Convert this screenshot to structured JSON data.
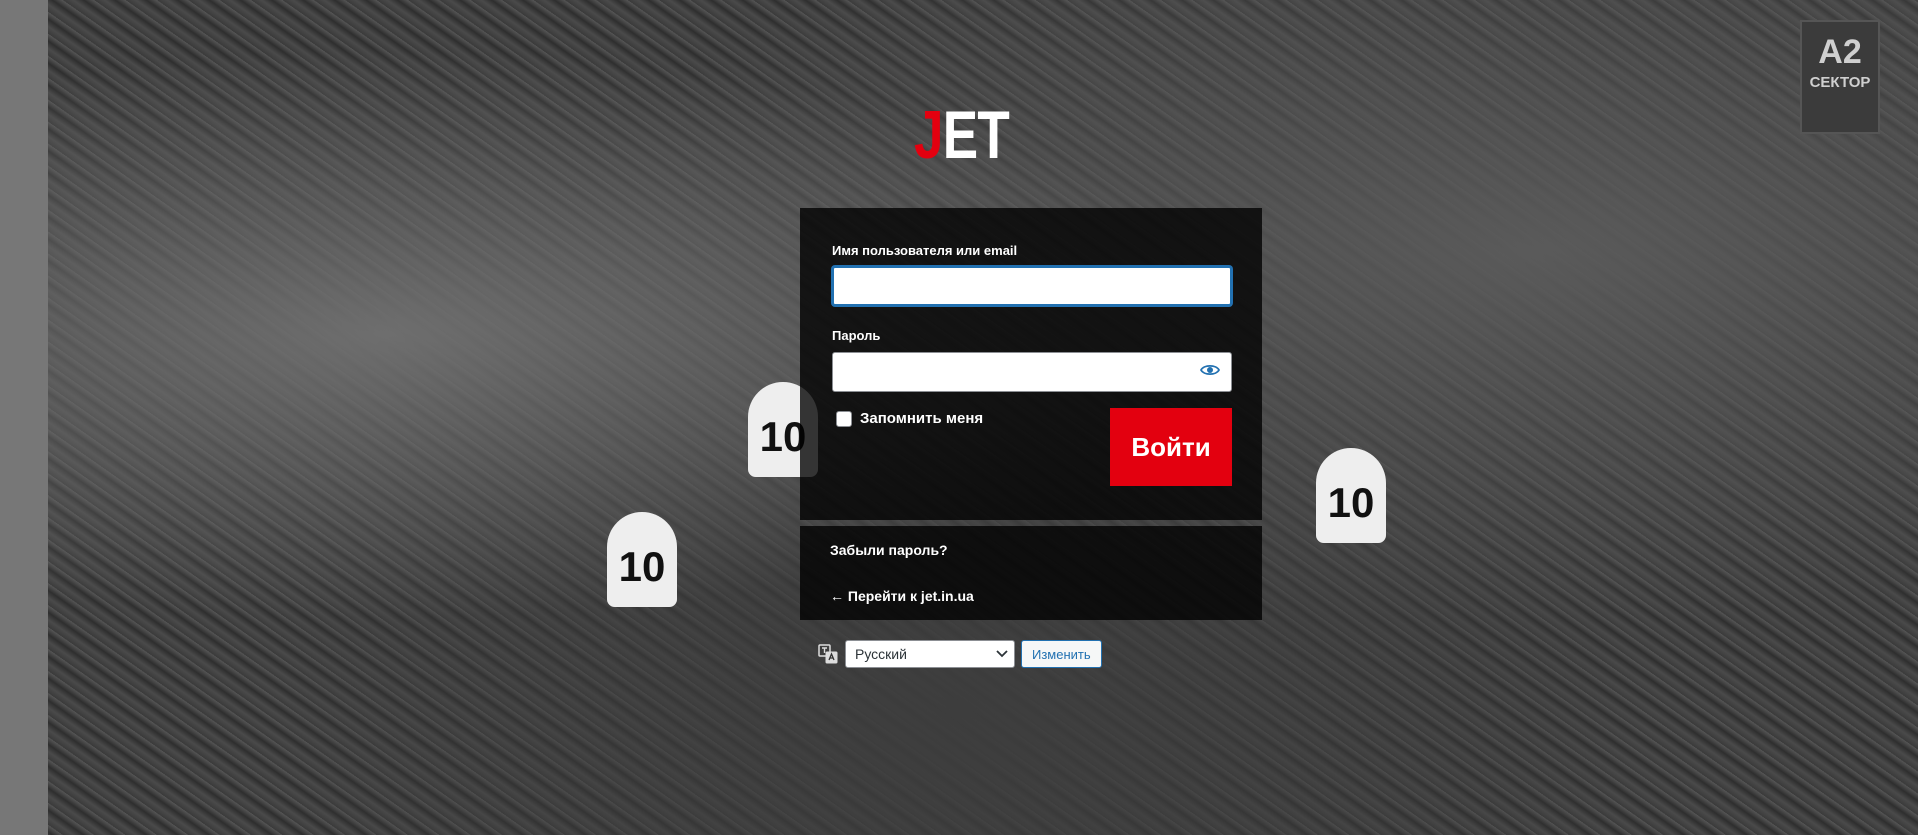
{
  "logo": {
    "first_letter": "J",
    "rest": "ET",
    "accent_color": "#e3000f"
  },
  "background": {
    "sector_sign_big": "A2",
    "sector_sign_small": "СЕКТОР",
    "score_card_text": "10"
  },
  "login": {
    "username_label": "Имя пользователя или email",
    "username_value": "",
    "password_label": "Пароль",
    "password_value": "",
    "show_password_icon": "eye-icon",
    "remember_label": "Запомнить меня",
    "remember_checked": false,
    "submit_label": "Войти",
    "submit_color": "#e3000f"
  },
  "links": {
    "lost_password": "Забыли пароль?",
    "back_to_site": "← Перейти к jet.in.ua"
  },
  "language": {
    "icon": "translate-icon",
    "selected": "Русский",
    "change_label": "Изменить",
    "button_accent": "#2271b1"
  }
}
